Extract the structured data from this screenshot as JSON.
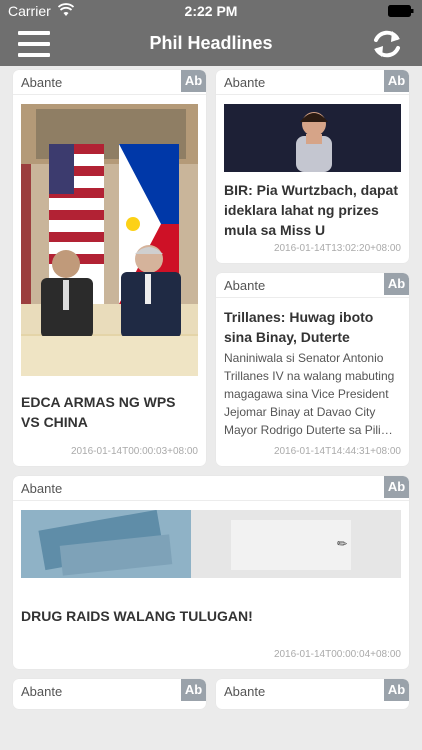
{
  "status": {
    "carrier": "Carrier",
    "time": "2:22 PM"
  },
  "nav": {
    "title": "Phil Headlines"
  },
  "cards": [
    {
      "source": "Abante",
      "badge": "Ab",
      "headline": "EDCA ARMAS NG WPS VS CHINA",
      "date": "2016-01-14T00:00:03+08:00"
    },
    {
      "source": "Abante",
      "badge": "Ab",
      "headline": "BIR: Pia Wurtzbach, dapat ideklara lahat ng prizes mula sa Miss U",
      "date": "2016-01-14T13:02:20+08:00"
    },
    {
      "source": "Abante",
      "badge": "Ab",
      "headline": "Trillanes: Huwag iboto sina Binay, Duterte",
      "summary": "Naniniwala si Senator Antonio Trillanes IV na walang mabuting magagawa sina Vice President Jejomar Binay at Davao City Mayor Rodrigo Duterte sa Pili…",
      "date": "2016-01-14T14:44:31+08:00"
    },
    {
      "source": "Abante",
      "badge": "Ab",
      "headline": "DRUG RAIDS WALANG TULUGAN!",
      "date": "2016-01-14T00:00:04+08:00"
    },
    {
      "source": "Abante",
      "badge": "Ab"
    },
    {
      "source": "Abante",
      "badge": "Ab"
    }
  ]
}
